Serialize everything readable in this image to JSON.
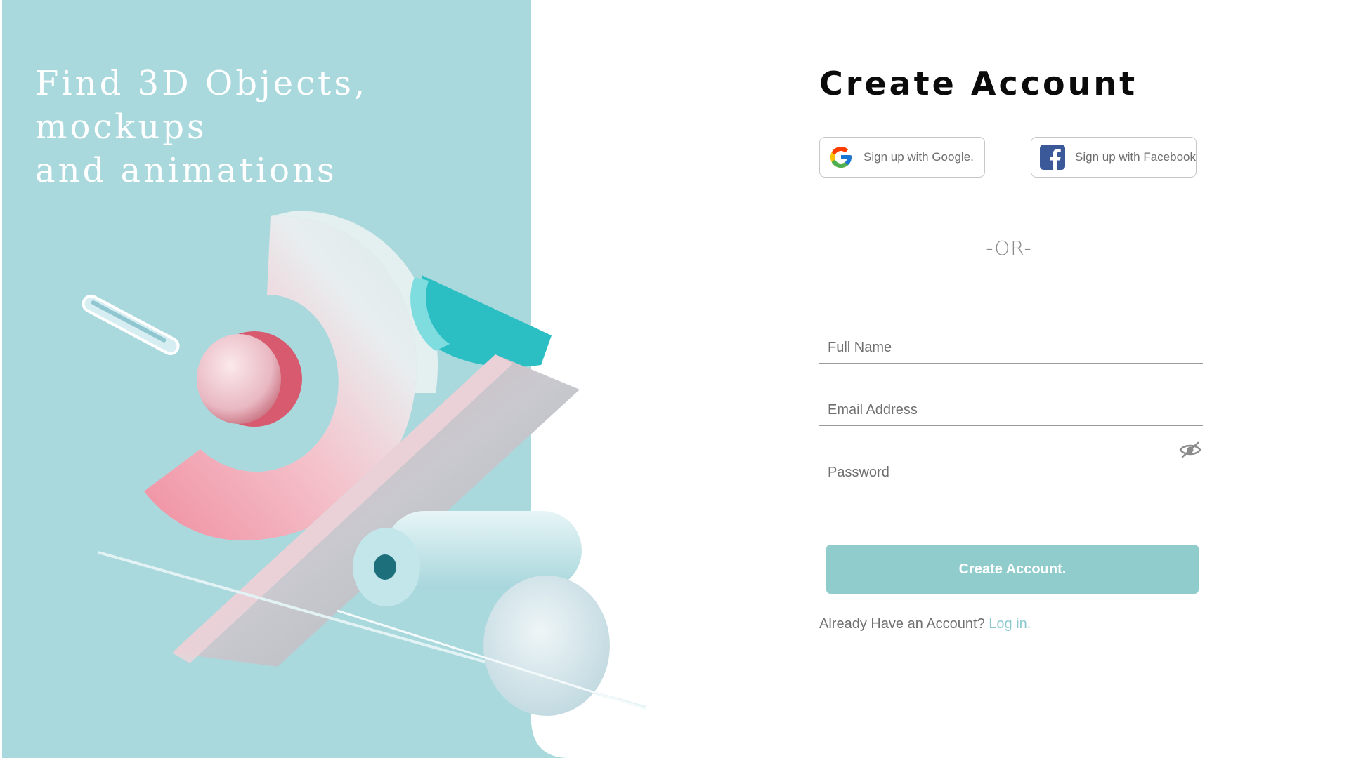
{
  "hero": {
    "title": "Find 3D Objects, mockups\n and animations",
    "background_color": "#aad9dd"
  },
  "form": {
    "heading": "Create Account",
    "google_button": {
      "label": "Sign up with Google.",
      "icon": "google-icon"
    },
    "facebook_button": {
      "label": "Sign up with Facebook",
      "icon": "facebook-icon"
    },
    "divider_text": "-OR-",
    "full_name": {
      "placeholder": "Full Name",
      "value": ""
    },
    "email": {
      "placeholder": "Email Address",
      "value": ""
    },
    "password": {
      "placeholder": "Password",
      "value": "",
      "toggle_icon": "eye-slash-icon"
    },
    "submit_label": "Create Account.",
    "login_prompt": "Already Have an Account?",
    "login_link": "Log in.",
    "accent_color": "#91cccc",
    "link_color": "#8ccad0"
  }
}
